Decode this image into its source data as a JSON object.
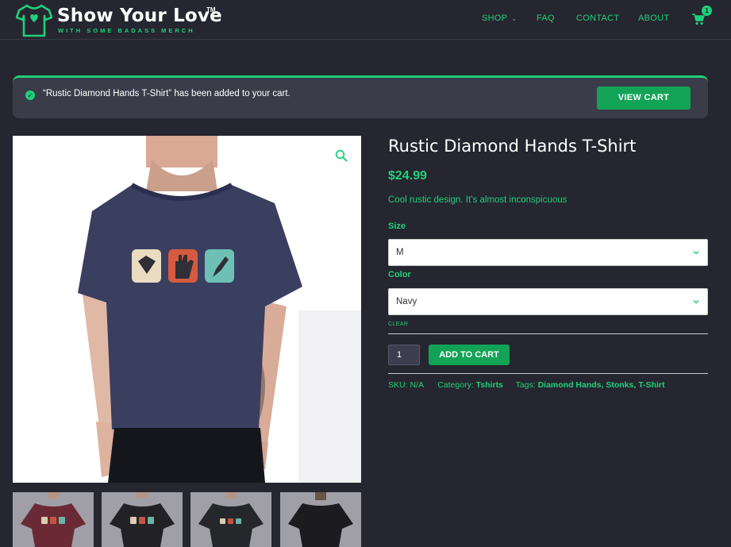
{
  "brand": {
    "title": "Show Your Love",
    "tm": "TM",
    "tagline": "WITH SOME BADASS MERCH",
    "accent": "#1fd07a"
  },
  "nav": {
    "items": [
      {
        "label": "SHOP",
        "has_dropdown": true
      },
      {
        "label": "FAQ"
      },
      {
        "label": "CONTACT"
      },
      {
        "label": "ABOUT"
      }
    ],
    "cart_count": "1",
    "cart_icon": "cart-icon"
  },
  "notice": {
    "message": "“Rustic Diamond Hands T-Shirt” has been added to your cart.",
    "button": "VIEW CART",
    "icon": "check-circle-icon"
  },
  "product": {
    "title": "Rustic Diamond Hands T-Shirt",
    "price": "$24.99",
    "short_description": "Cool rustic design. It’s almost inconspicuous",
    "size_label": "Size",
    "size_value": "M",
    "color_label": "Color",
    "color_value": "Navy",
    "clear": "CLEAR",
    "quantity": "1",
    "add_to_cart": "ADD TO CART",
    "sku_label": "SKU:",
    "sku_value": "N/A",
    "category_label": "Category:",
    "category": "Tshirts",
    "tags_label": "Tags:",
    "tags": "Diamond Hands, Stonks, T-Shirt",
    "shirt_colors": {
      "navy": "#3a3f60",
      "thumb_1": "#6a2a35",
      "thumb_2": "#222226",
      "thumb_3": "#26272b",
      "thumb_4": "#1c1c1f"
    }
  }
}
